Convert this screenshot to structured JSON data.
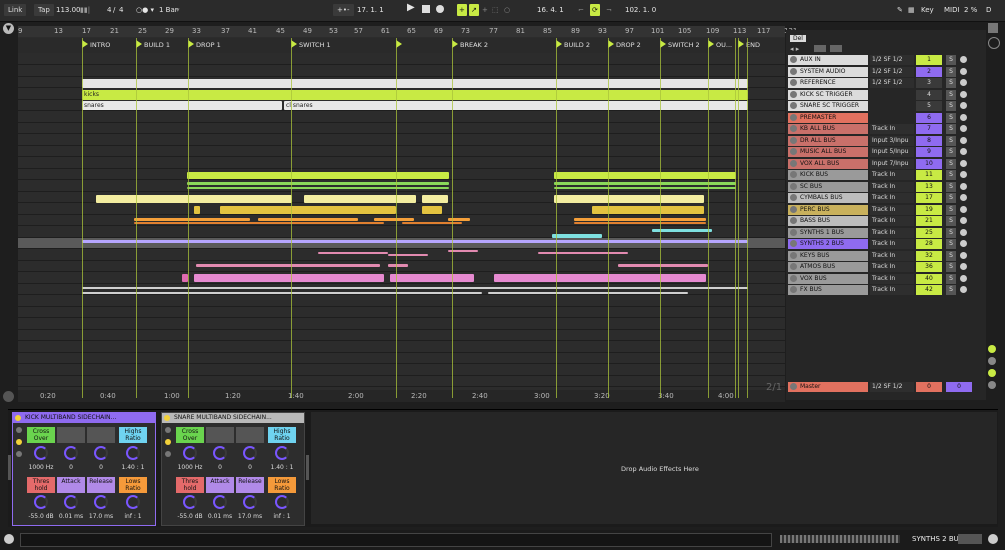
{
  "transport": {
    "link": "Link",
    "tap": "Tap",
    "tempo": "113.00",
    "sig_num": "4",
    "sig_den": "4",
    "quant": "1 Bar",
    "pos": "17.  1.  1",
    "loop_start": "16.  4.  1",
    "loop_len": "102.  1.  0",
    "key": "Key",
    "midi": "MIDI",
    "cpu": "2 %",
    "d": "D"
  },
  "ruler": [
    "9",
    "13",
    "17",
    "21",
    "25",
    "29",
    "33",
    "37",
    "41",
    "45",
    "49",
    "53",
    "57",
    "61",
    "65",
    "69",
    "73",
    "77",
    "81",
    "85",
    "89",
    "93",
    "97",
    "101",
    "105",
    "109",
    "113",
    "117",
    "121"
  ],
  "locators": [
    "INTRO",
    "BUILD 1",
    "DROP 1",
    "SWITCH 1",
    "",
    "BREAK 2",
    "BUILD 2",
    "DROP 2",
    "SWITCH 2",
    "OU...",
    "END"
  ],
  "clips": {
    "kicks": "kicks",
    "snares": "snares",
    "cl_snares": "cl snares"
  },
  "timeline": [
    "0:20",
    "0:40",
    "1:00",
    "1:20",
    "1:40",
    "2:00",
    "2:20",
    "2:40",
    "3:00",
    "3:20",
    "3:40",
    "4:00"
  ],
  "page_ratio": "2/1",
  "mixer": {
    "del": "Del",
    "tracks": [
      {
        "name": "AUX IN",
        "input": "1/2 SF 1/2",
        "num": "1",
        "color": "#dcdcdc",
        "numc": "#c8ea44"
      },
      {
        "name": "SYSTEM AUDIO",
        "input": "1/2 SF 1/2",
        "num": "2",
        "color": "#dcdcdc",
        "numc": "#8f6bf0"
      },
      {
        "name": "REFERENCE",
        "input": "1/2 SF 1/2",
        "num": "3",
        "color": "#dcdcdc",
        "numc": "#3a3a3a"
      },
      {
        "name": "KICK SC TRIGGER",
        "input": "",
        "num": "4",
        "color": "#dcdcdc",
        "numc": "#3a3a3a"
      },
      {
        "name": "SNARE SC TRIGGER",
        "input": "",
        "num": "5",
        "color": "#dcdcdc",
        "numc": "#3a3a3a"
      },
      {
        "name": "PREMASTER",
        "input": "",
        "num": "6",
        "color": "#e2715f",
        "numc": "#8f6bf0"
      },
      {
        "name": "KB ALL BUS",
        "input": "Track In",
        "num": "7",
        "color": "#c9706a",
        "numc": "#8f6bf0"
      },
      {
        "name": "DR ALL BUS",
        "input": "Input 3/Inpu",
        "num": "8",
        "color": "#c9706a",
        "numc": "#8f6bf0"
      },
      {
        "name": "MUSIC ALL BUS",
        "input": "Input 5/Inpu",
        "num": "9",
        "color": "#c9706a",
        "numc": "#8f6bf0"
      },
      {
        "name": "VOX ALL BUS",
        "input": "Input 7/Inpu",
        "num": "10",
        "color": "#c9706a",
        "numc": "#8f6bf0"
      },
      {
        "name": "KICK BUS",
        "input": "Track In",
        "num": "11",
        "color": "#9a9a9a",
        "numc": "#c8ea44"
      },
      {
        "name": "SC BUS",
        "input": "Track In",
        "num": "13",
        "color": "#9a9a9a",
        "numc": "#c8ea44"
      },
      {
        "name": "CYMBALS BUS",
        "input": "Track In",
        "num": "17",
        "color": "#bdbdbd",
        "numc": "#c8ea44"
      },
      {
        "name": "PERC BUS",
        "input": "Track In",
        "num": "19",
        "color": "#c9b15c",
        "numc": "#c8ea44"
      },
      {
        "name": "BASS BUS",
        "input": "Track In",
        "num": "21",
        "color": "#bdbdbd",
        "numc": "#c8ea44"
      },
      {
        "name": "SYNTHS 1 BUS",
        "input": "Track In",
        "num": "25",
        "color": "#9a9a9a",
        "numc": "#c8ea44"
      },
      {
        "name": "SYNTHS 2 BUS",
        "input": "Track In",
        "num": "28",
        "color": "#8f6bf0",
        "numc": "#c8ea44"
      },
      {
        "name": "KEYS BUS",
        "input": "Track In",
        "num": "32",
        "color": "#9a9a9a",
        "numc": "#c8ea44"
      },
      {
        "name": "ATMOS BUS",
        "input": "Track In",
        "num": "36",
        "color": "#9a9a9a",
        "numc": "#c8ea44"
      },
      {
        "name": "VOX BUS",
        "input": "Track In",
        "num": "40",
        "color": "#9a9a9a",
        "numc": "#c8ea44"
      },
      {
        "name": "FX BUS",
        "input": "Track In",
        "num": "42",
        "color": "#9a9a9a",
        "numc": "#c8ea44"
      }
    ],
    "master": "Master",
    "master_in": "1/2 SF 1/2",
    "master_a": "0",
    "master_b": "0"
  },
  "devices": [
    {
      "title": "KICK MULTIBAND SIDECHAIN...",
      "cross": "Cross Over",
      "highs": "Highs Ratio",
      "freq": "1000 Hz",
      "v1": "0",
      "v2": "0",
      "ratio": "1.40 : 1",
      "thres": "Thres hold",
      "attack": "Attack",
      "release": "Release",
      "lows": "Lows Ratio",
      "db": "-55.0 dB",
      "ms1": "0.01 ms",
      "ms2": "17.0 ms",
      "inf": "inf : 1"
    },
    {
      "title": "SNARE MULTIBAND SIDECHAIN...",
      "cross": "Cross Over",
      "highs": "Highs Ratio",
      "freq": "1000 Hz",
      "v1": "0",
      "v2": "0",
      "ratio": "1.40 : 1",
      "thres": "Thres hold",
      "attack": "Attack",
      "release": "Release",
      "lows": "Lows Ratio",
      "db": "-55.0 dB",
      "ms1": "0.01 ms",
      "ms2": "17.0 ms",
      "inf": "inf : 1"
    }
  ],
  "drop_hint": "Drop Audio Effects Here",
  "status_track": "SYNTHS 2 BUS"
}
